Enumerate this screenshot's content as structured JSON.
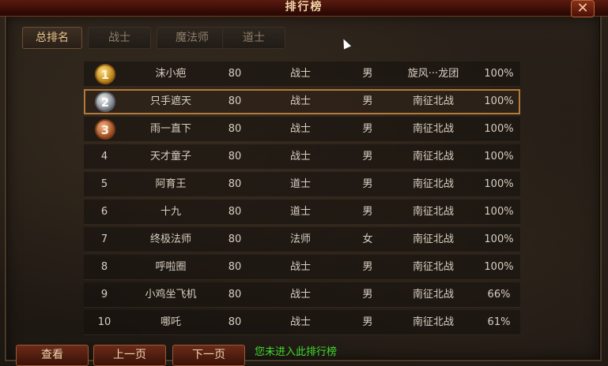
{
  "window": {
    "title": "排行榜",
    "close_icon": "close-icon"
  },
  "tabs": [
    {
      "label": "总排名",
      "active": true
    },
    {
      "label": "战士",
      "active": false
    },
    {
      "label": "魔法师",
      "active": false
    },
    {
      "label": "道士",
      "active": false
    }
  ],
  "rankings": [
    {
      "rank": "1",
      "medal": "gold",
      "name": "沫小疤",
      "level": "80",
      "class": "战士",
      "gender": "男",
      "guild": "旋风···龙团",
      "percent": "100%"
    },
    {
      "rank": "2",
      "medal": "silver",
      "name": "只手遮天",
      "level": "80",
      "class": "战士",
      "gender": "男",
      "guild": "南征北战",
      "percent": "100%",
      "selected": true
    },
    {
      "rank": "3",
      "medal": "bronze",
      "name": "雨一直下",
      "level": "80",
      "class": "战士",
      "gender": "男",
      "guild": "南征北战",
      "percent": "100%"
    },
    {
      "rank": "4",
      "name": "天才童子",
      "level": "80",
      "class": "战士",
      "gender": "男",
      "guild": "南征北战",
      "percent": "100%"
    },
    {
      "rank": "5",
      "name": "阿育王",
      "level": "80",
      "class": "道士",
      "gender": "男",
      "guild": "南征北战",
      "percent": "100%"
    },
    {
      "rank": "6",
      "name": "十九",
      "level": "80",
      "class": "道士",
      "gender": "男",
      "guild": "南征北战",
      "percent": "100%"
    },
    {
      "rank": "7",
      "name": "终极法师",
      "level": "80",
      "class": "法师",
      "gender": "女",
      "guild": "南征北战",
      "percent": "100%"
    },
    {
      "rank": "8",
      "name": "呼啦圈",
      "level": "80",
      "class": "战士",
      "gender": "男",
      "guild": "南征北战",
      "percent": "100%"
    },
    {
      "rank": "9",
      "name": "小鸡坐飞机",
      "level": "80",
      "class": "战士",
      "gender": "男",
      "guild": "南征北战",
      "percent": "66%"
    },
    {
      "rank": "10",
      "name": "哪吒",
      "level": "80",
      "class": "战士",
      "gender": "男",
      "guild": "南征北战",
      "percent": "61%"
    }
  ],
  "buttons": {
    "view": "查看",
    "prev": "上一页",
    "next": "下一页"
  },
  "notice": "您未进入此排行榜",
  "colors": {
    "accent": "#b37a3a",
    "notice": "#3fdc2f",
    "title": "#f1d8a8"
  }
}
